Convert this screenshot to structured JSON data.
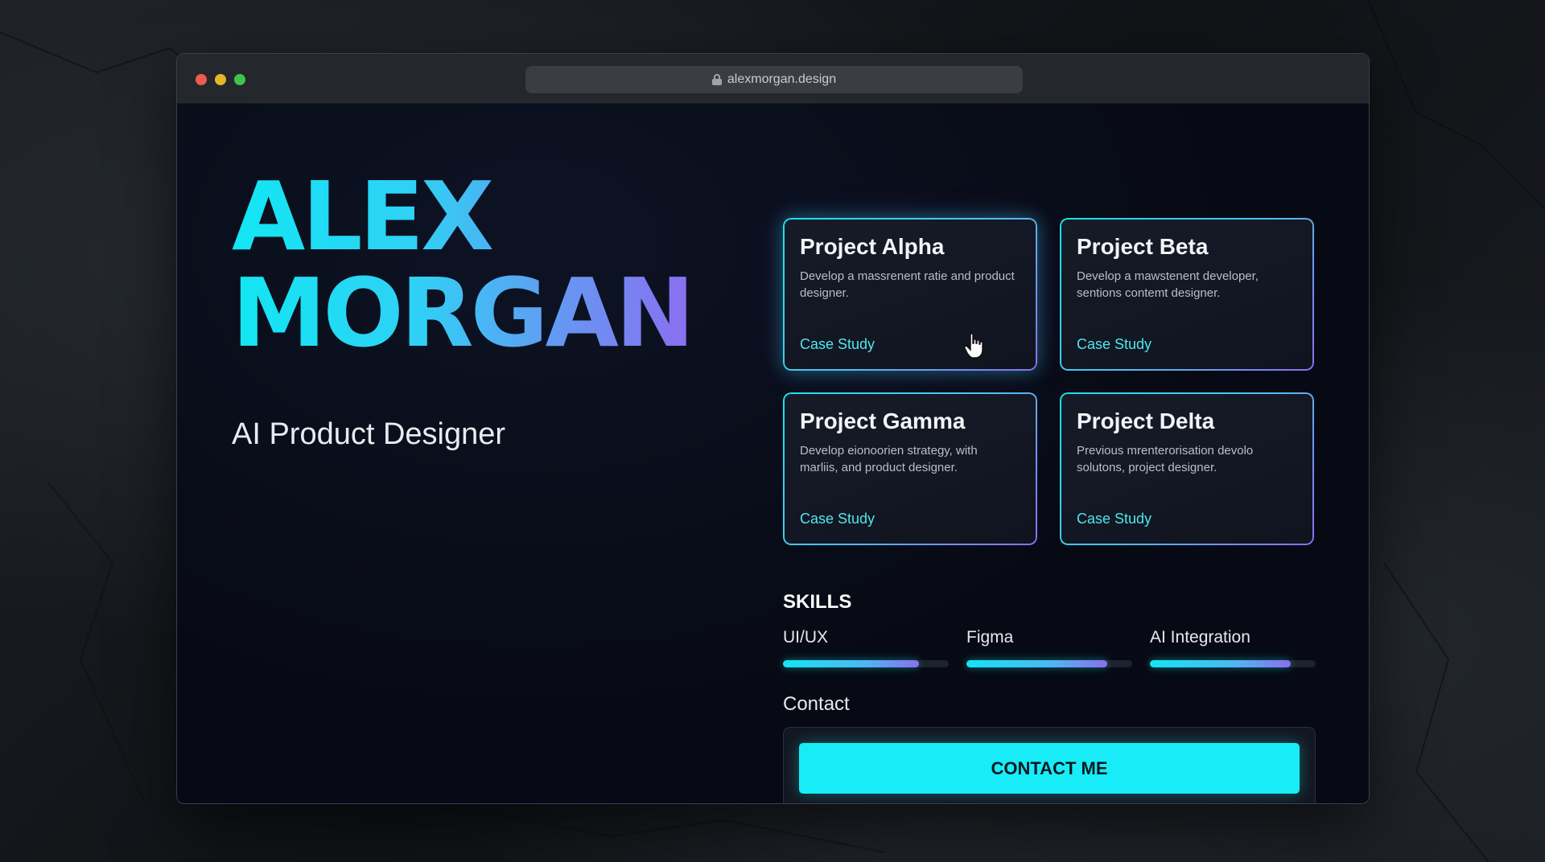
{
  "browser": {
    "url": "alexmorgan.design",
    "url_icon": "lock-icon"
  },
  "hero": {
    "first_name": "ALEX",
    "last_name": "MORGAN",
    "role": "AI Product Designer"
  },
  "projects": [
    {
      "title": "Project Alpha",
      "description": "Develop a massrenent ratie and product designer.",
      "link": "Case Study"
    },
    {
      "title": "Project Beta",
      "description": "Develop a mawstenent developer, sentions contemt designer.",
      "link": "Case Study"
    },
    {
      "title": "Project Gamma",
      "description": "Develop eionoorien strategy, with marliis, and product designer.",
      "link": "Case Study"
    },
    {
      "title": "Project Delta",
      "description": "Previous mrenterorisation devolo solutons, project designer.",
      "link": "Case Study"
    }
  ],
  "skills": {
    "heading": "SKILLS",
    "items": [
      {
        "label": "UI/UX",
        "level": 0.82
      },
      {
        "label": "Figma",
        "level": 0.85
      },
      {
        "label": "AI Integration",
        "level": 0.85
      }
    ]
  },
  "contact": {
    "heading": "Contact",
    "button_label": "CONTACT ME"
  },
  "colors": {
    "accent_cyan": "#18ecf6",
    "accent_purple": "#8b6ef0",
    "background": "#080c17"
  }
}
